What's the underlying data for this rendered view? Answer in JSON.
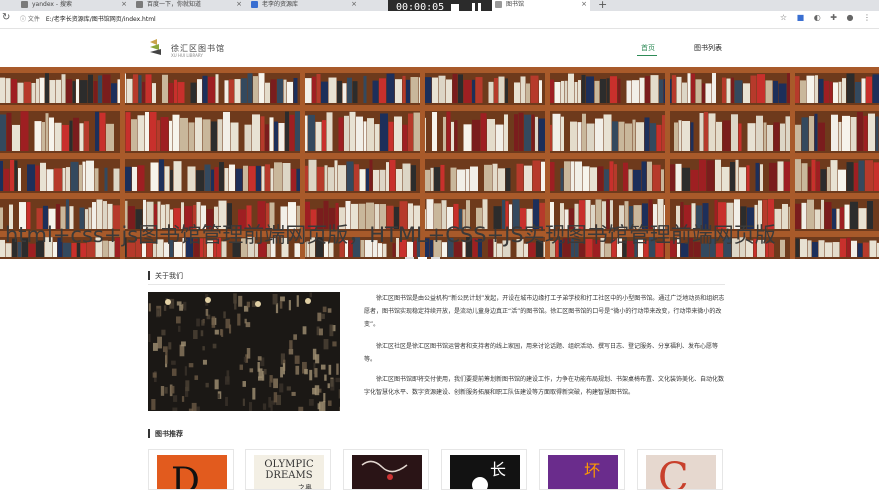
{
  "browser": {
    "tabs": [
      {
        "label": "yandex - 搜索"
      },
      {
        "label": "百度一下，你就知道"
      },
      {
        "label": "老李的资源库"
      },
      {
        "label": "图书馆"
      }
    ],
    "url": "E:/老李长资源库/图书馆网页/index.html",
    "url_info": "文件"
  },
  "video": {
    "time": "00:00:05"
  },
  "site": {
    "logo_text": "徐汇区图书馆",
    "logo_sub": "XU HUI LIBRARY",
    "nav": {
      "home": "首页",
      "books": "图书列表"
    }
  },
  "banner": {
    "slides": 3,
    "active_slide": 1
  },
  "watermark": "html+css+js图书馆管理前端网页版，HTML+CSS+JS实现图书馆管理前端网页版",
  "about": {
    "title": "关于我们",
    "paragraphs": [
      "徐汇区图书馆是由公益机构“新公民计划”发起，开设在城市边缘打工子弟学校和打工社区中的小型图书馆。通过广泛地动员和组织志愿者，图书馆实现稳定持续开放，是流动儿童身边真正“活”的图书馆。徐汇区图书馆的口号是“微小的行动带来改变，行动带来微小的改变”。",
      "徐汇区社区是徐汇区图书馆运营者和支持者的线上家园，用来讨论话题、组织活动、撰写日志、登记服务、分享福利、发布心愿等等。",
      "徐汇区图书馆即将交付使用，我们要提前筹划新图书馆的建设工作，力争在功能布局规划、书架桌椅布置、文化装饰美化、自动化数字化智慧化水平、数字资源建设、创新服务拓展和职工队伍建设等方面取得新突破，构建智慧图书馆。"
    ]
  },
  "books": {
    "title": "图书推荐",
    "covers": [
      {
        "text": "D",
        "color": "#e25b1e"
      },
      {
        "text": "OLYMPIC DREAMS",
        "sub": "之奥",
        "color": "#f3efe4"
      },
      {
        "text": "",
        "color": "#2a1416"
      },
      {
        "text": "长",
        "color": "#121212"
      },
      {
        "text": "坏",
        "color": "#6a2c8c"
      },
      {
        "text": "C",
        "color": "#e6d8cf"
      }
    ]
  }
}
